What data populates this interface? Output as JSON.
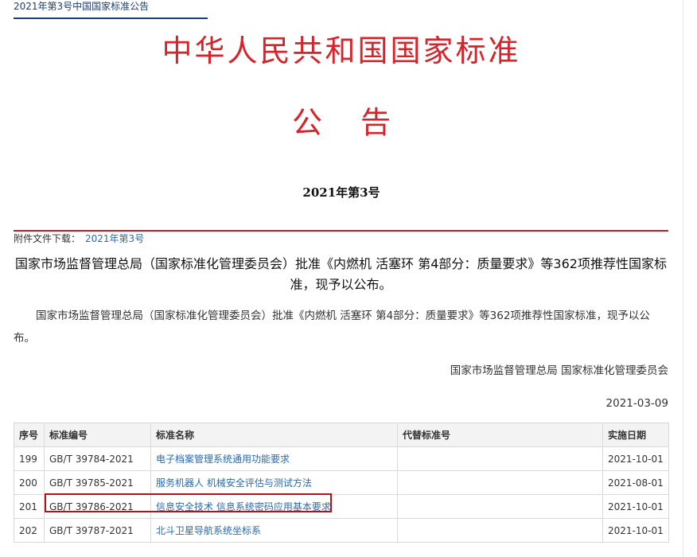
{
  "breadcrumb": "2021年第3号中国国家标准公告",
  "header": {
    "title": "中华人民共和国国家标准",
    "subtitle": "公告",
    "issue": "2021年第3号"
  },
  "attachment": {
    "label": "附件文件下载：",
    "link_text": "2021年第3号"
  },
  "headline": "国家市场监督管理总局（国家标准化管理委员会）批准《内燃机 活塞环 第4部分：质量要求》等362项推荐性国家标准，现予以公布。",
  "body": "国家市场监督管理总局（国家标准化管理委员会）批准《内燃机 活塞环 第4部分：质量要求》等362项推荐性国家标准，现予以公布。",
  "signature": "国家市场监督管理总局 国家标准化管理委员会",
  "date": "2021-03-09",
  "table": {
    "headers": {
      "seq": "序号",
      "code": "标准编号",
      "name": "标准名称",
      "replace": "代替标准号",
      "effective": "实施日期"
    },
    "rows": [
      {
        "seq": "199",
        "code": "GB/T 39784-2021",
        "name": "电子档案管理系统通用功能要求",
        "replace": "",
        "effective": "2021-10-01"
      },
      {
        "seq": "200",
        "code": "GB/T 39785-2021",
        "name": "服务机器人 机械安全评估与测试方法",
        "replace": "",
        "effective": "2021-08-01"
      },
      {
        "seq": "201",
        "code": "GB/T 39786-2021",
        "name": "信息安全技术 信息系统密码应用基本要求",
        "replace": "",
        "effective": "2021-10-01"
      },
      {
        "seq": "202",
        "code": "GB/T 39787-2021",
        "name": "北斗卫星导航系统坐标系",
        "replace": "",
        "effective": "2021-10-01"
      }
    ]
  },
  "colors": {
    "accent_red": "#d9232b",
    "link_blue": "#2a6ab1",
    "highlight": "#b3121a",
    "crumb_navy": "#1a3e77"
  }
}
